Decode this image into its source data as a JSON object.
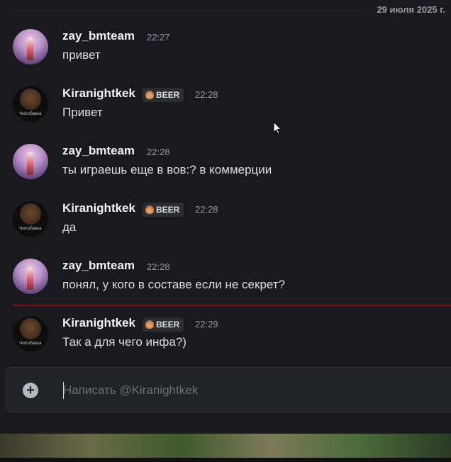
{
  "date_divider": "29 июля 2025 г.",
  "messages": [
    {
      "user": "zay_bmteam",
      "tag": "",
      "time": "22:27",
      "text": "привет",
      "avatar": "zay"
    },
    {
      "user": "Kiranightkek",
      "tag": "BEER",
      "time": "22:28",
      "text": "Привет",
      "avatar": "kira"
    },
    {
      "user": "zay_bmteam",
      "tag": "",
      "time": "22:28",
      "text": "ты играешь еще в вов:? в коммерции",
      "avatar": "zay"
    },
    {
      "user": "Kiranightkek",
      "tag": "BEER",
      "time": "22:28",
      "text": "да",
      "avatar": "kira"
    },
    {
      "user": "zay_bmteam",
      "tag": "",
      "time": "22:28",
      "text": "понял, у кого в составе если не секрет?",
      "avatar": "zay"
    },
    {
      "user": "Kiranightkek",
      "tag": "BEER",
      "time": "22:29",
      "text": "Так а для чего инфа?)",
      "avatar": "kira"
    }
  ],
  "avatar_caption": "Чилобакка",
  "composer": {
    "placeholder": "Написать @Kiranightkek",
    "plus_icon": "plus-circle-icon"
  },
  "colors": {
    "background": "#1a1a1e",
    "new_message_line": "#a12d34",
    "username": "#f2f3f5",
    "timestamp": "#949ba4"
  }
}
